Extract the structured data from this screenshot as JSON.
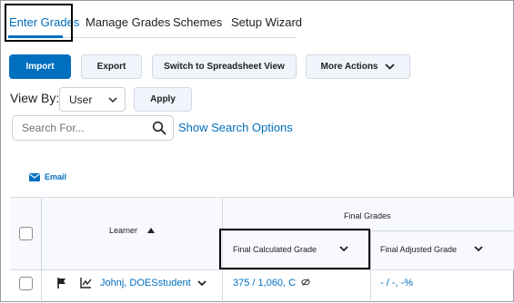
{
  "tabs": [
    {
      "label": "Enter Grades",
      "active": true
    },
    {
      "label": "Manage Grades",
      "active": false
    },
    {
      "label": "Schemes",
      "active": false
    },
    {
      "label": "Setup Wizard",
      "active": false
    }
  ],
  "toolbar": {
    "import_label": "Import",
    "export_label": "Export",
    "spreadsheet_label": "Switch to Spreadsheet View",
    "more_actions_label": "More Actions"
  },
  "view_by": {
    "label": "View By:",
    "selected": "User",
    "apply_label": "Apply"
  },
  "search": {
    "placeholder": "Search For...",
    "options_link": "Show Search Options"
  },
  "email": {
    "label": "Email"
  },
  "grid": {
    "learner_header": "Learner",
    "group_header": "Final Grades",
    "col_calculated": "Final Calculated Grade",
    "col_adjusted": "Final Adjusted Grade",
    "rows": [
      {
        "name": "Johnj, DOESstudent",
        "calculated": "375 / 1,060, C",
        "adjusted": "- / -, -%"
      }
    ]
  },
  "colors": {
    "accent": "#006fbf",
    "highlight_border": "#000000"
  }
}
